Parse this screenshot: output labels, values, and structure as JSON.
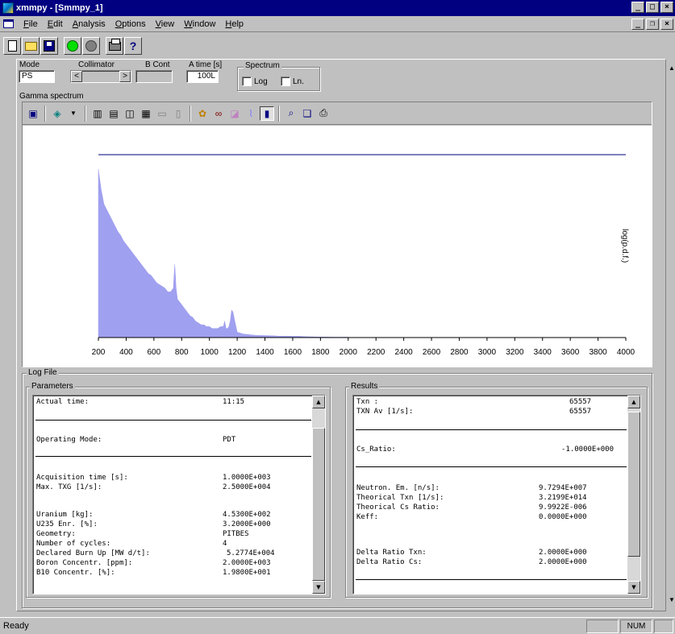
{
  "window": {
    "title": "xmmpy - [Smmpy_1]",
    "minimize": "_",
    "maximize": "□",
    "close": "×"
  },
  "menu": {
    "items": [
      {
        "u": "F",
        "rest": "ile"
      },
      {
        "u": "E",
        "rest": "dit"
      },
      {
        "u": "A",
        "rest": "nalysis"
      },
      {
        "u": "O",
        "rest": "ptions"
      },
      {
        "u": "V",
        "rest": "iew"
      },
      {
        "u": "W",
        "rest": "indow"
      },
      {
        "u": "H",
        "rest": "elp"
      }
    ],
    "mdi_minimize": "_",
    "mdi_restore": "❐",
    "mdi_close": "×"
  },
  "controls": {
    "mode_label": "Mode",
    "mode_value": "PS",
    "collimator_label": "Collimator",
    "collimator_left": "<",
    "collimator_right": ">",
    "b_cont_label": "B Cont",
    "b_cont_value": "",
    "a_time_label": "A time [s]",
    "a_time_value": "100L",
    "spectrum_title": "Spectrum",
    "log_label": "Log",
    "ln_label": "Ln."
  },
  "gamma_title": "Gamma spectrum",
  "chart_data": {
    "type": "area",
    "x": [
      200,
      220,
      240,
      260,
      280,
      300,
      320,
      340,
      360,
      380,
      400,
      420,
      440,
      460,
      480,
      500,
      520,
      540,
      560,
      580,
      600,
      620,
      640,
      660,
      680,
      700,
      720,
      740,
      750,
      760,
      770,
      780,
      800,
      820,
      840,
      860,
      880,
      900,
      920,
      940,
      960,
      980,
      1000,
      1020,
      1040,
      1060,
      1080,
      1100,
      1110,
      1120,
      1130,
      1140,
      1150,
      1160,
      1170,
      1180,
      1200,
      1220,
      1240,
      1260,
      1300,
      1340,
      1400,
      1450,
      1500,
      1560,
      1600,
      1650,
      1700,
      1800,
      1900,
      2000
    ],
    "y": [
      0.92,
      0.81,
      0.73,
      0.7,
      0.67,
      0.64,
      0.61,
      0.58,
      0.56,
      0.53,
      0.51,
      0.49,
      0.47,
      0.45,
      0.43,
      0.41,
      0.39,
      0.37,
      0.35,
      0.34,
      0.32,
      0.3,
      0.29,
      0.28,
      0.27,
      0.25,
      0.25,
      0.27,
      0.4,
      0.27,
      0.21,
      0.2,
      0.18,
      0.16,
      0.14,
      0.12,
      0.11,
      0.09,
      0.08,
      0.07,
      0.07,
      0.06,
      0.06,
      0.05,
      0.05,
      0.05,
      0.06,
      0.06,
      0.09,
      0.05,
      0.05,
      0.06,
      0.09,
      0.15,
      0.14,
      0.1,
      0.03,
      0.025,
      0.02,
      0.018,
      0.015,
      0.012,
      0.011,
      0.01,
      0.008,
      0.008,
      0.007,
      0.007,
      0.005,
      0.003,
      0.002,
      0.002
    ],
    "xlim": [
      200,
      4000
    ],
    "ylim": [
      0,
      1
    ],
    "x_ticks": [
      "200",
      "400",
      "600",
      "800",
      "1000",
      "1200",
      "1400",
      "1600",
      "1800",
      "2000",
      "2200",
      "2400",
      "2600",
      "2800",
      "3000",
      "3200",
      "3400",
      "3600",
      "3800",
      "4000"
    ],
    "ylabel": "log(p.d.f.)",
    "fill_color": "#a0a0f0",
    "grid": false
  },
  "logfile": {
    "title": "Log File",
    "parameters_title": "Parameters",
    "results_title": "Results",
    "parameters": [
      {
        "label": "Actual time:",
        "value": "11:15"
      },
      {
        "label": "Operating Mode:",
        "value": "PDT"
      },
      {
        "label": "Acquisition time [s]:",
        "value": "1.0000E+003"
      },
      {
        "label": "Max. TXG [1/s]:",
        "value": "2.5000E+004"
      },
      {
        "label": "Uranium [kg]:",
        "value": "4.5300E+002"
      },
      {
        "label": "U235 Enr. [%]:",
        "value": "3.2000E+000"
      },
      {
        "label": "Geometry:",
        "value": "PITBES"
      },
      {
        "label": "Number of cycles:",
        "value": "4"
      },
      {
        "label": "Declared Burn Up [MW d/t]:",
        "value": "5.2774E+004"
      },
      {
        "label": "Boron Concentr. [ppm]:",
        "value": "2.0000E+003"
      },
      {
        "label": "B10 Concentr. [%]:",
        "value": "1.9800E+001"
      }
    ],
    "results": [
      {
        "label": "Txn :",
        "value": "65557"
      },
      {
        "label": "TXN Av [1/s]:",
        "value": "65557"
      },
      {
        "label": "Cs_Ratio:",
        "value": "-1.0000E+000"
      },
      {
        "label": "Neutron. Em. [n/s]:",
        "value": "9.7294E+007"
      },
      {
        "label": "Theorical Txn [1/s]:",
        "value": "3.2199E+014"
      },
      {
        "label": "Theorical Cs Ratio:",
        "value": "9.9922E-006"
      },
      {
        "label": "Keff:",
        "value": "0.0000E+000"
      },
      {
        "label": "Delta Ratio Txn:",
        "value": "2.0000E+000"
      },
      {
        "label": "Delta Ratio Cs:",
        "value": "2.0000E+000"
      }
    ]
  },
  "status": {
    "text": "Ready",
    "num": "NUM"
  }
}
